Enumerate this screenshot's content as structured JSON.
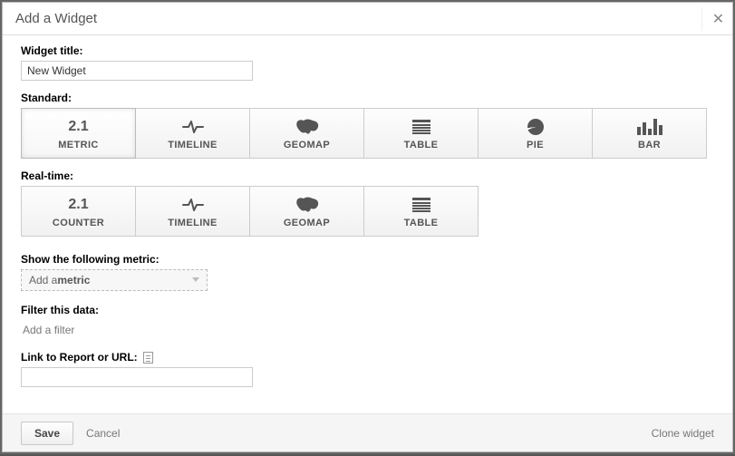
{
  "dialog": {
    "title": "Add a Widget"
  },
  "fields": {
    "widget_title_label": "Widget title:",
    "widget_title_value": "New Widget",
    "standard_label": "Standard:",
    "realtime_label": "Real-time:",
    "metric_section_label": "Show the following metric:",
    "metric_select_prefix": "Add a ",
    "metric_select_word": "metric",
    "filter_label": "Filter this data:",
    "filter_link": "Add a filter",
    "link_label": "Link to Report or URL:",
    "link_value": ""
  },
  "tiles_standard": [
    {
      "key": "metric",
      "label": "METRIC",
      "big": "2.1",
      "selected": true
    },
    {
      "key": "timeline",
      "label": "TIMELINE"
    },
    {
      "key": "geomap",
      "label": "GEOMAP"
    },
    {
      "key": "table",
      "label": "TABLE"
    },
    {
      "key": "pie",
      "label": "PIE"
    },
    {
      "key": "bar",
      "label": "BAR"
    }
  ],
  "tiles_realtime": [
    {
      "key": "counter",
      "label": "COUNTER",
      "big": "2.1"
    },
    {
      "key": "timeline",
      "label": "TIMELINE"
    },
    {
      "key": "geomap",
      "label": "GEOMAP"
    },
    {
      "key": "table",
      "label": "TABLE"
    }
  ],
  "footer": {
    "save": "Save",
    "cancel": "Cancel",
    "clone": "Clone widget"
  }
}
